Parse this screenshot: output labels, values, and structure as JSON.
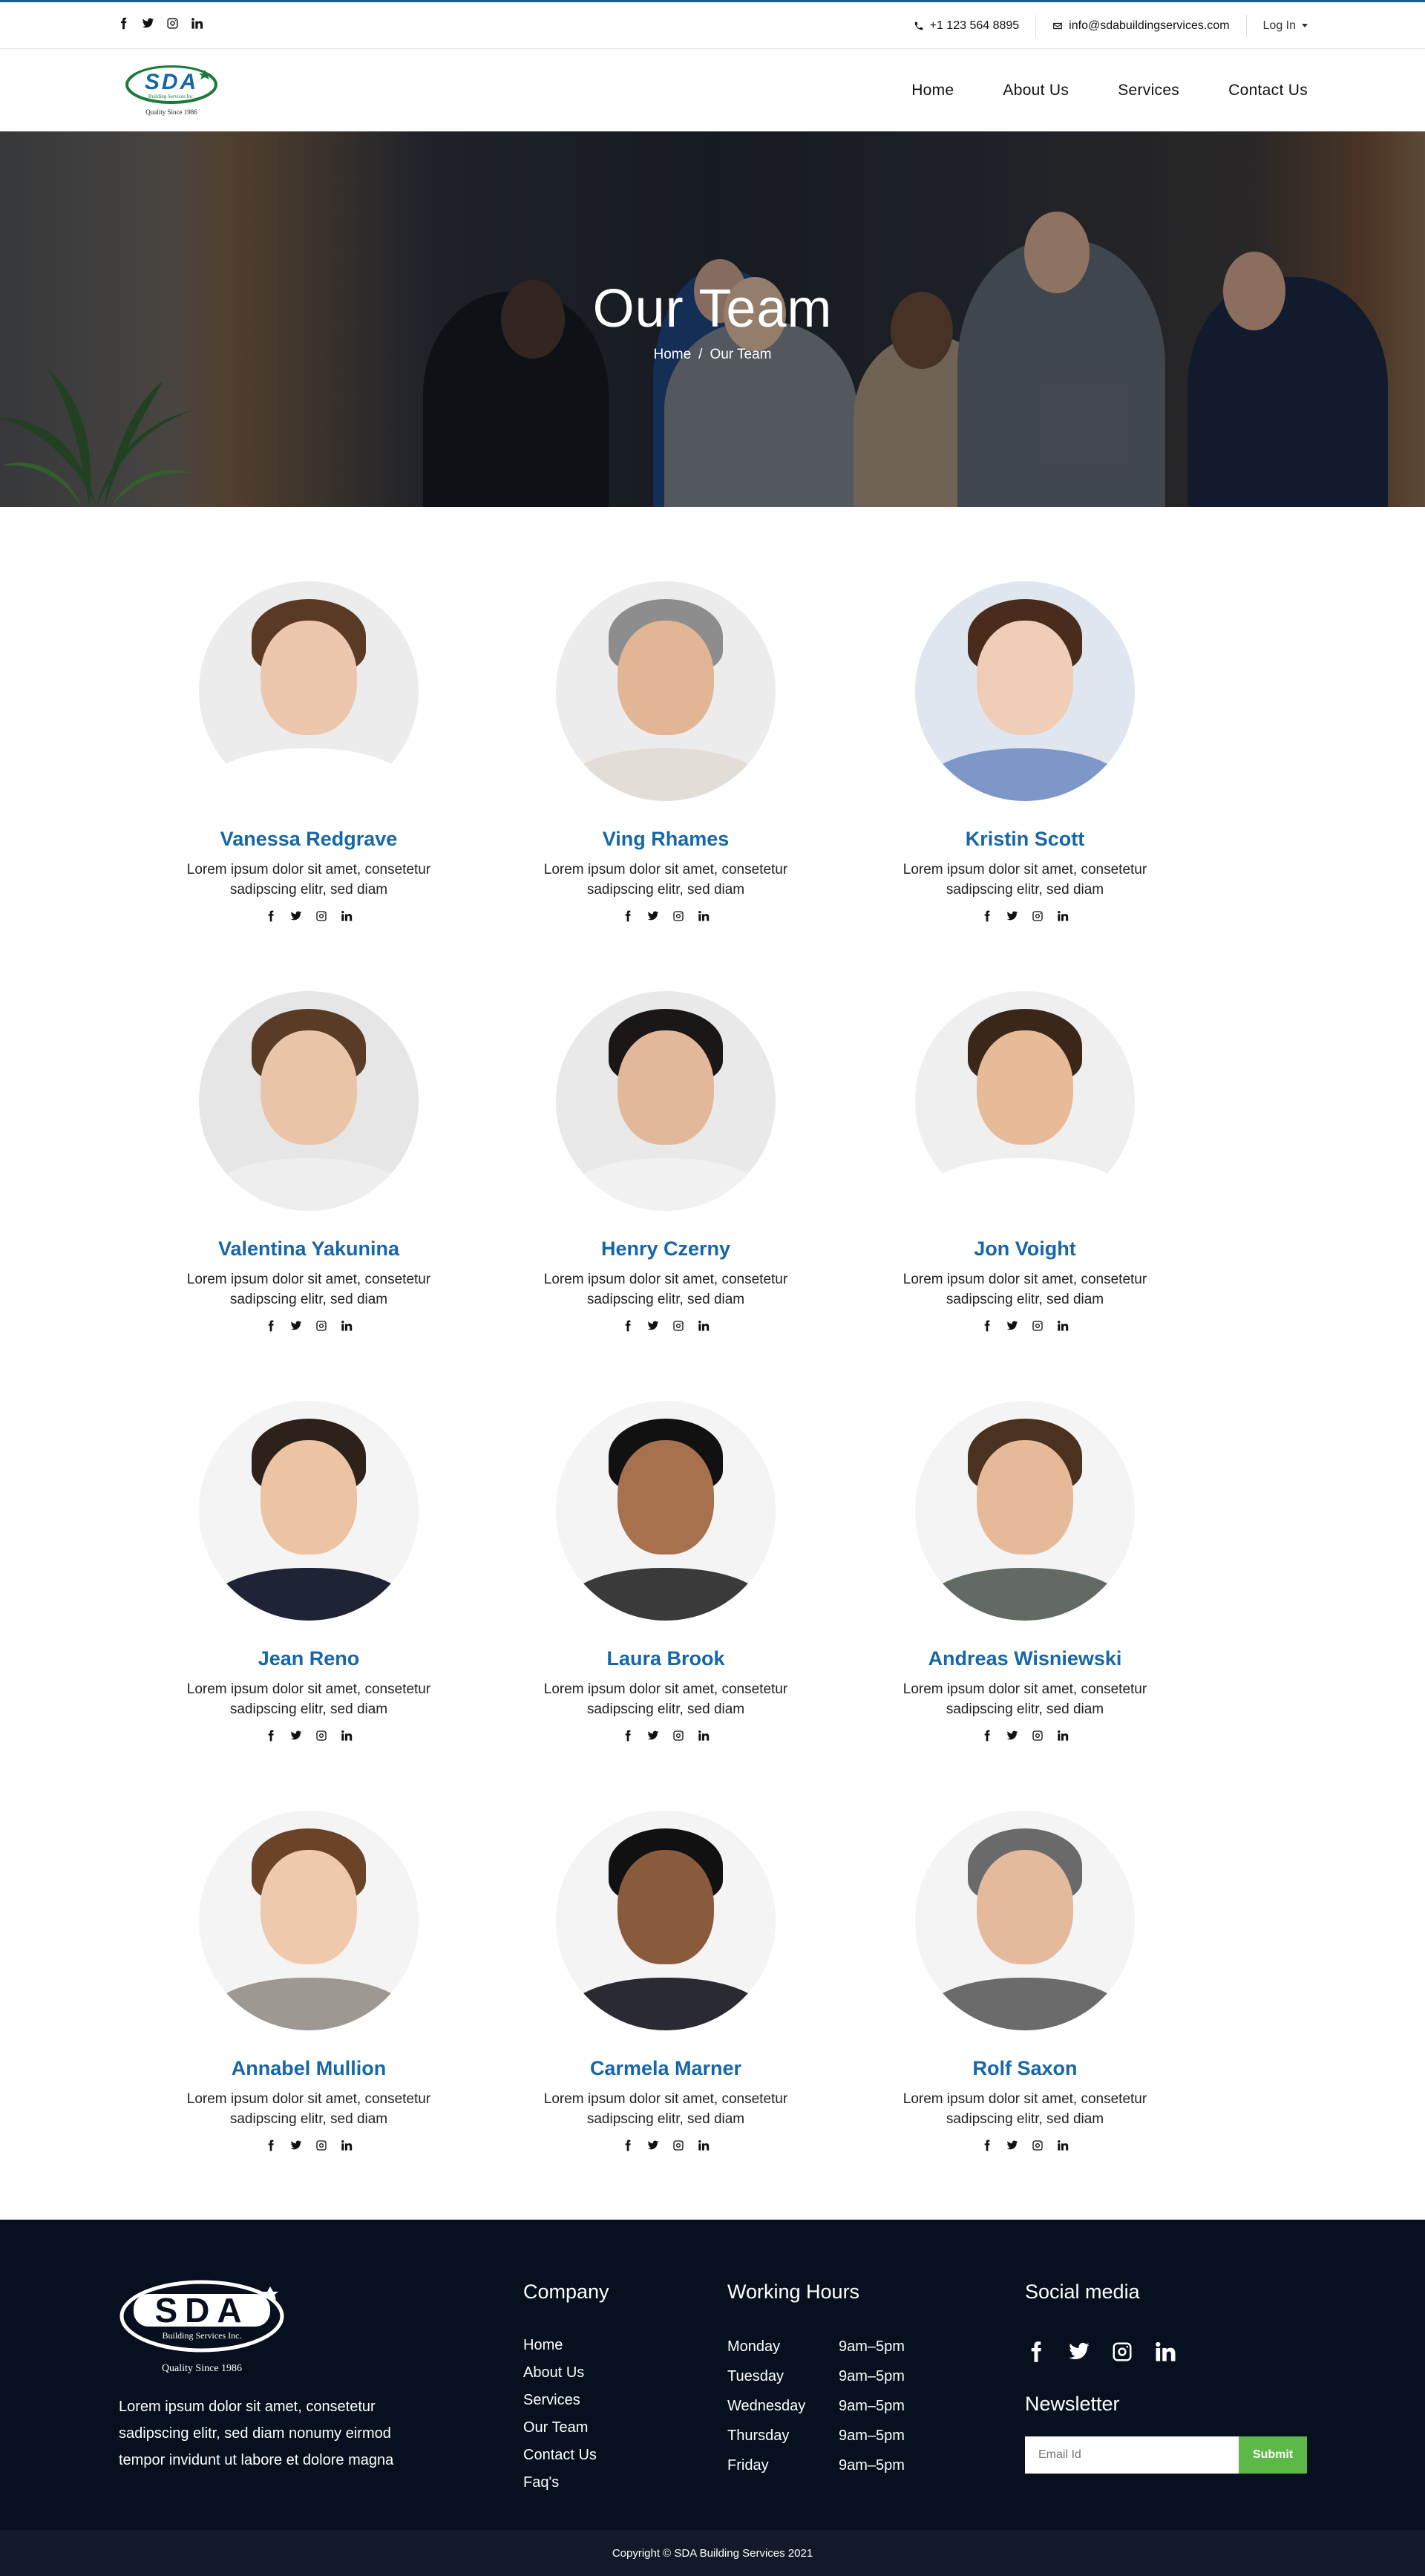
{
  "topbar": {
    "socials": [
      "facebook-icon",
      "twitter-icon",
      "instagram-icon",
      "linkedin-icon"
    ],
    "phone": "+1 123 564 8895",
    "email": "info@sdabuildingservices.com",
    "login": "Log In"
  },
  "brand": {
    "logo_text": "SDA",
    "logo_sub": "Building Services Inc.",
    "tagline": "Quality Since 1986"
  },
  "nav": {
    "items": [
      "Home",
      "About Us",
      "Services",
      "Contact Us"
    ]
  },
  "hero": {
    "title": "Our Team",
    "breadcrumb_home": "Home",
    "breadcrumb_sep": "/",
    "breadcrumb_current": "Our Team"
  },
  "team": {
    "members": [
      {
        "name": "Vanessa Redgrave",
        "bio_line1": "Lorem ipsum dolor sit amet, consetetur",
        "bio_line2": "sadipscing elitr, sed diam"
      },
      {
        "name": "Ving Rhames",
        "bio_line1": "Lorem ipsum dolor sit amet, consetetur",
        "bio_line2": "sadipscing elitr, sed diam"
      },
      {
        "name": "Kristin Scott",
        "bio_line1": "Lorem ipsum dolor sit amet, consetetur",
        "bio_line2": "sadipscing elitr, sed diam"
      },
      {
        "name": "Valentina Yakunina",
        "bio_line1": "Lorem ipsum dolor sit amet, consetetur",
        "bio_line2": "sadipscing elitr, sed diam"
      },
      {
        "name": "Henry Czerny",
        "bio_line1": "Lorem ipsum dolor sit amet, consetetur",
        "bio_line2": "sadipscing elitr, sed diam"
      },
      {
        "name": "Jon Voight",
        "bio_line1": "Lorem ipsum dolor sit amet, consetetur",
        "bio_line2": "sadipscing elitr, sed diam"
      },
      {
        "name": "Jean Reno",
        "bio_line1": "Lorem ipsum dolor sit amet, consetetur",
        "bio_line2": "sadipscing elitr, sed diam"
      },
      {
        "name": "Laura Brook",
        "bio_line1": "Lorem ipsum dolor sit amet, consetetur",
        "bio_line2": "sadipscing elitr, sed diam"
      },
      {
        "name": "Andreas Wisniewski",
        "bio_line1": "Lorem ipsum dolor sit amet, consetetur",
        "bio_line2": "sadipscing elitr, sed diam"
      },
      {
        "name": "Annabel Mullion",
        "bio_line1": "Lorem ipsum dolor sit amet, consetetur",
        "bio_line2": "sadipscing elitr, sed diam"
      },
      {
        "name": "Carmela Marner",
        "bio_line1": "Lorem ipsum dolor sit amet, consetetur",
        "bio_line2": "sadipscing elitr, sed diam"
      },
      {
        "name": "Rolf Saxon",
        "bio_line1": "Lorem ipsum dolor sit amet, consetetur",
        "bio_line2": "sadipscing elitr, sed diam"
      }
    ]
  },
  "footer": {
    "about_line1": "Lorem ipsum dolor sit amet, consetetur",
    "about_line2": "sadipscing elitr, sed diam nonumy eirmod",
    "about_line3": "tempor invidunt ut labore et dolore magna",
    "company_title": "Company",
    "company_links": [
      "Home",
      "About Us",
      "Services",
      "Our Team",
      "Contact Us",
      "Faq's"
    ],
    "hours_title": "Working Hours",
    "hours": [
      {
        "day": "Monday",
        "time": "9am–5pm"
      },
      {
        "day": "Tuesday",
        "time": "9am–5pm"
      },
      {
        "day": "Wednesday",
        "time": "9am–5pm"
      },
      {
        "day": "Thursday",
        "time": "9am–5pm"
      },
      {
        "day": "Friday",
        "time": "9am–5pm"
      }
    ],
    "social_title": "Social media",
    "newsletter_title": "Newsletter",
    "email_placeholder": "Email Id",
    "submit_label": "Submit"
  },
  "copyright": "Copyright © SDA Building Services 2021",
  "colors": {
    "accent_blue": "#1666a8",
    "footer_bg": "#06101f",
    "copyright_bg": "#121a2a",
    "submit_green": "#5cb947"
  }
}
